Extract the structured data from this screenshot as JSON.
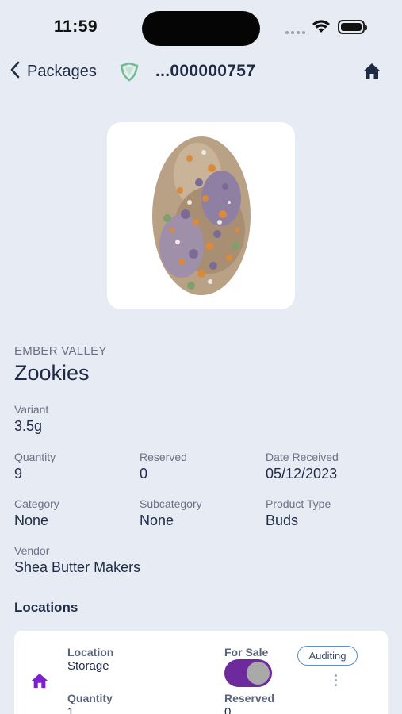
{
  "status_bar": {
    "time": "11:59"
  },
  "nav": {
    "back_label": "Packages",
    "package_id": "...000000757"
  },
  "product": {
    "brand": "EMBER VALLEY",
    "name": "Zookies",
    "image_icon": "cannabis-bud-image"
  },
  "details": {
    "variant": {
      "label": "Variant",
      "value": "3.5g"
    },
    "quantity": {
      "label": "Quantity",
      "value": "9"
    },
    "reserved": {
      "label": "Reserved",
      "value": "0"
    },
    "date_received": {
      "label": "Date Received",
      "value": "05/12/2023"
    },
    "category": {
      "label": "Category",
      "value": "None"
    },
    "subcategory": {
      "label": "Subcategory",
      "value": "None"
    },
    "product_type": {
      "label": "Product Type",
      "value": "Buds"
    },
    "vendor": {
      "label": "Vendor",
      "value": "Shea Butter Makers"
    }
  },
  "locations": {
    "title": "Locations",
    "items": [
      {
        "location_label": "Location",
        "location_value": "Storage",
        "for_sale_label": "For Sale",
        "for_sale_on": true,
        "badge": "Auditing",
        "quantity_label": "Quantity",
        "quantity_value": "1",
        "reserved_label": "Reserved",
        "reserved_value": "0"
      }
    ]
  },
  "colors": {
    "background": "#e6ebf4",
    "accent_purple": "#6c2a9c",
    "home_icon_purple": "#7b1fd0",
    "shield_green": "#6fbf8e",
    "badge_border": "#5a8fd8"
  }
}
